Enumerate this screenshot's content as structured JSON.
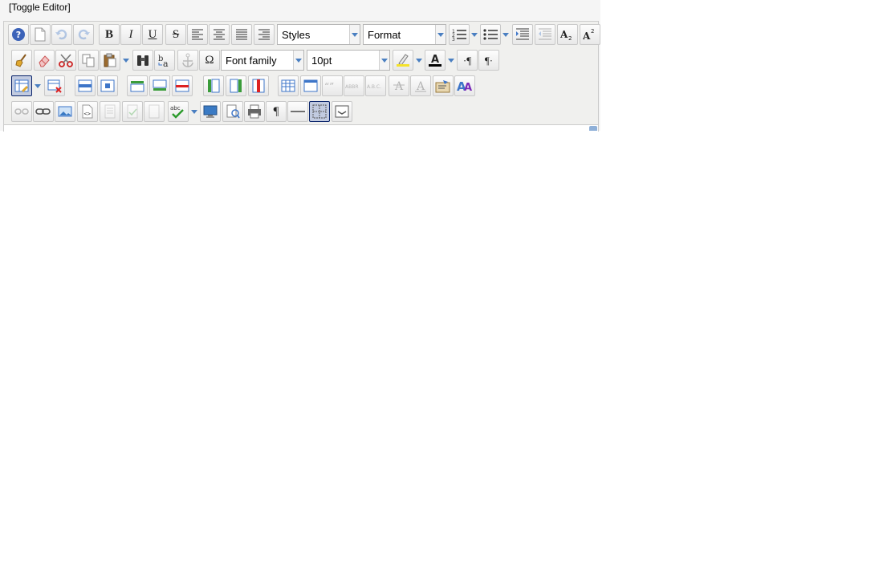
{
  "toggle_label": "[Toggle Editor]",
  "toolbar": {
    "row1": {
      "styles_value": "Styles",
      "format_value": "Format",
      "bold_glyph": "B",
      "italic_glyph": "I",
      "underline_glyph": "U",
      "strike_glyph": "S"
    },
    "row2": {
      "font_family_value": "Font family",
      "font_size_value": "10pt",
      "charmap_glyph": "Ω",
      "ltr_glyph": "·¶",
      "rtl_glyph": "¶·"
    },
    "row4": {
      "pilcrow_glyph": "¶"
    }
  },
  "colors": {
    "arrow_blue": "#4a7fc1",
    "active_border": "#0a246a",
    "highlight_yellow": "#f5e22a"
  }
}
